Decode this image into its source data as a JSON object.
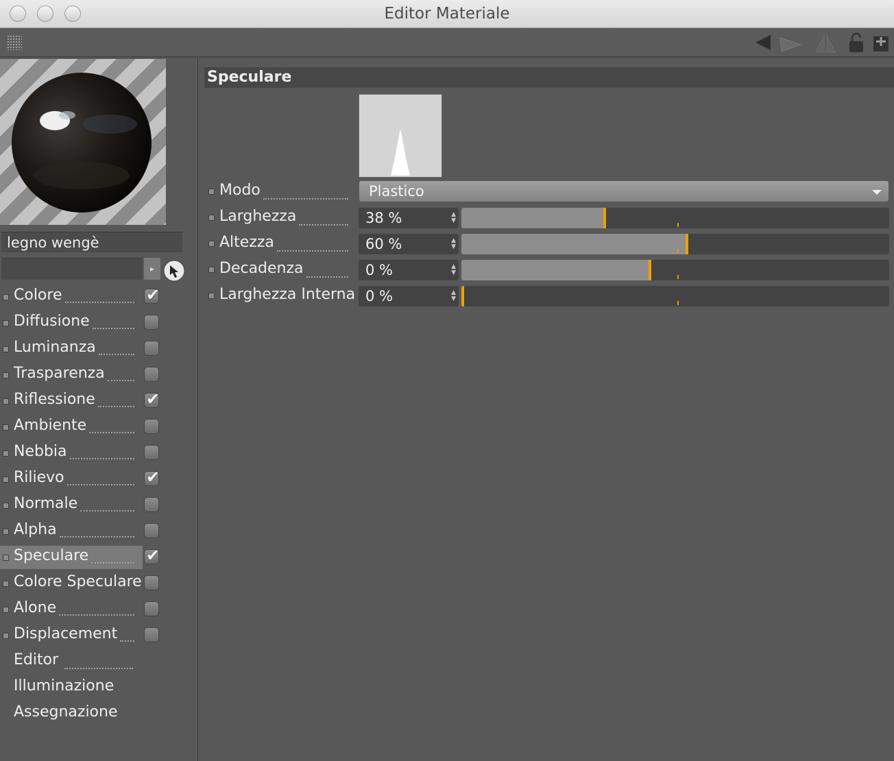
{
  "window": {
    "title": "Editor Materiale"
  },
  "material": {
    "name": "legno wengè",
    "sub_field": ""
  },
  "channels": [
    {
      "label": "Colore",
      "checked": true
    },
    {
      "label": "Diffusione",
      "checked": false
    },
    {
      "label": "Luminanza",
      "checked": false
    },
    {
      "label": "Trasparenza",
      "checked": false
    },
    {
      "label": "Riflessione",
      "checked": true
    },
    {
      "label": "Ambiente",
      "checked": false
    },
    {
      "label": "Nebbia",
      "checked": false
    },
    {
      "label": "Rilievo",
      "checked": true
    },
    {
      "label": "Normale",
      "checked": false
    },
    {
      "label": "Alpha",
      "checked": false
    },
    {
      "label": "Speculare",
      "checked": true,
      "active": true
    },
    {
      "label": "Colore Speculare",
      "checked": false
    },
    {
      "label": "Alone",
      "checked": false
    },
    {
      "label": "Displacement",
      "checked": false
    }
  ],
  "extra_items": [
    "Editor",
    "Illuminazione",
    "Assegnazione"
  ],
  "panel": {
    "title": "Speculare",
    "mode": {
      "label": "Modo",
      "value": "Plastico"
    },
    "params": [
      {
        "label": "Larghezza",
        "value": "38 %",
        "fraction": 0.38
      },
      {
        "label": "Altezza",
        "value": "60 %",
        "fraction": 0.6
      },
      {
        "label": "Decadenza",
        "value": "0 %",
        "fraction": 0.5
      },
      {
        "label": "Larghezza Interna",
        "value": "0 %",
        "fraction": 0.0
      }
    ]
  },
  "icons": {
    "toolbar": [
      "grip-icon",
      "back-arrow-icon",
      "forward-arrow-icon",
      "pyramid-icon",
      "lock-icon",
      "new-window-icon"
    ],
    "picker": "pick-cursor-icon"
  },
  "colors": {
    "accent": "#f0a000",
    "background": "#585858"
  }
}
